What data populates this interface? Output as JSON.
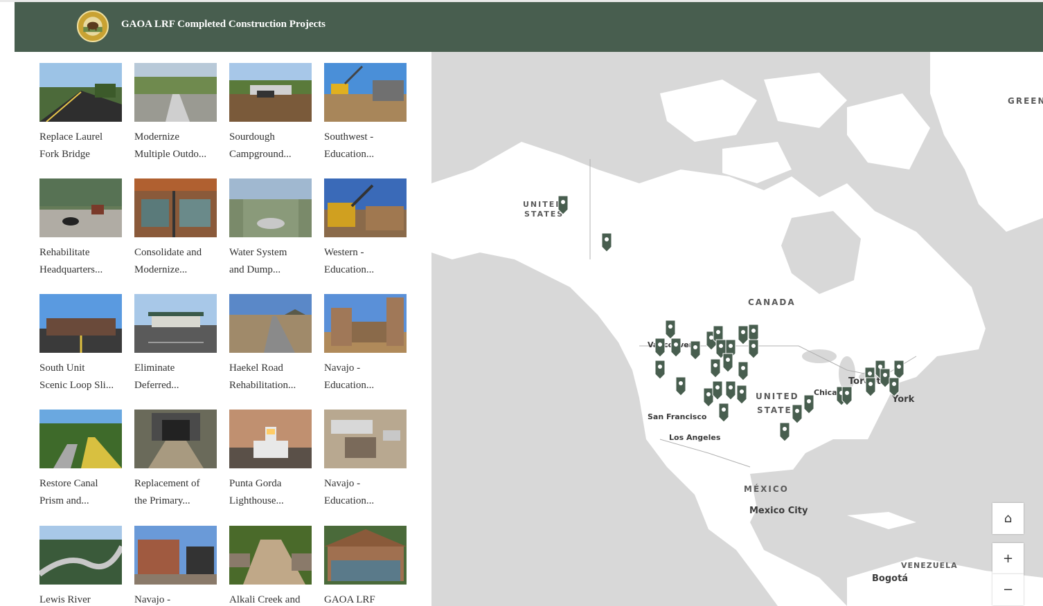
{
  "header": {
    "title": "GAOA LRF Completed Construction Projects",
    "background": "#485e4f"
  },
  "gallery": {
    "cards": [
      {
        "line1": "Replace Laurel",
        "line2": "Fork Bridge"
      },
      {
        "line1": "Modernize",
        "line2": "Multiple Outdo..."
      },
      {
        "line1": "Sourdough",
        "line2": "Campground..."
      },
      {
        "line1": "Southwest -",
        "line2": "Education..."
      },
      {
        "line1": "Rehabilitate",
        "line2": "Headquarters..."
      },
      {
        "line1": "Consolidate and",
        "line2": "Modernize..."
      },
      {
        "line1": "Water System",
        "line2": "and Dump..."
      },
      {
        "line1": "Western -",
        "line2": "Education..."
      },
      {
        "line1": "South Unit",
        "line2": "Scenic Loop Sli..."
      },
      {
        "line1": "Eliminate",
        "line2": "Deferred..."
      },
      {
        "line1": "Haekel Road",
        "line2": "Rehabilitation..."
      },
      {
        "line1": "Navajo -",
        "line2": "Education..."
      },
      {
        "line1": "Restore Canal",
        "line2": "Prism and..."
      },
      {
        "line1": "Replacement of",
        "line2": "the Primary..."
      },
      {
        "line1": "Punta Gorda",
        "line2": "Lighthouse..."
      },
      {
        "line1": "Navajo -",
        "line2": "Education..."
      },
      {
        "line1": "Lewis River",
        "line2": ""
      },
      {
        "line1": "Navajo -",
        "line2": ""
      },
      {
        "line1": "Alkali Creek and",
        "line2": ""
      },
      {
        "line1": "GAOA LRF",
        "line2": ""
      }
    ]
  },
  "map": {
    "labels": {
      "greenland": "GREEN",
      "us_alaska_1": "UNITED",
      "us_alaska_2": "STATES",
      "canada": "CANADA",
      "vancouver": "Vancouver",
      "us_1": "UNITED",
      "us_2": "STATES",
      "chicago": "Chicago",
      "toronto": "Toronto",
      "new_york": "York",
      "san_francisco": "San Francisco",
      "los_angeles": "Los Angeles",
      "mexico": "MÉXICO",
      "mexico_city": "Mexico City",
      "venezuela": "VENEZUELA",
      "bogota": "Bogotá"
    },
    "controls": {
      "home": "⌂",
      "zoom_in": "+",
      "zoom_out": "−"
    },
    "pin_color": "#485e4f",
    "land_color": "#ffffff",
    "water_color": "#d8d8d8"
  }
}
